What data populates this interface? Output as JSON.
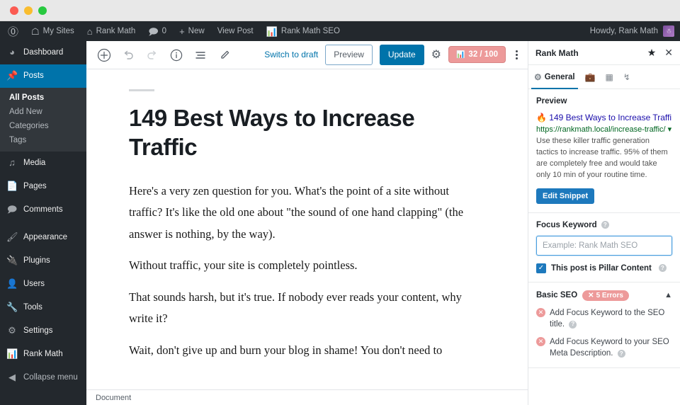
{
  "adminbar": {
    "logo_icon": "wordpress-logo-icon",
    "items": [
      {
        "label": "My Sites",
        "icon": "sites-icon"
      },
      {
        "label": "Rank Math",
        "icon": "home-icon"
      },
      {
        "label": "0",
        "icon": "comment-icon"
      },
      {
        "label": "New",
        "icon": "plus-icon"
      },
      {
        "label": "View Post",
        "icon": ""
      },
      {
        "label": "Rank Math SEO",
        "icon": "rankmath-icon"
      }
    ],
    "howdy": "Howdy, Rank Math"
  },
  "adminmenu": {
    "items": [
      {
        "label": "Dashboard",
        "icon": "dashboard-icon",
        "current": false
      },
      {
        "label": "Posts",
        "icon": "pin-icon",
        "current": true
      },
      {
        "label": "Media",
        "icon": "media-icon",
        "current": false
      },
      {
        "label": "Pages",
        "icon": "pages-icon",
        "current": false
      },
      {
        "label": "Comments",
        "icon": "comments-icon",
        "current": false
      },
      {
        "label": "Appearance",
        "icon": "appearance-icon",
        "current": false
      },
      {
        "label": "Plugins",
        "icon": "plugins-icon",
        "current": false
      },
      {
        "label": "Users",
        "icon": "users-icon",
        "current": false
      },
      {
        "label": "Tools",
        "icon": "tools-icon",
        "current": false
      },
      {
        "label": "Settings",
        "icon": "settings-icon",
        "current": false
      },
      {
        "label": "Rank Math",
        "icon": "rankmath-icon",
        "current": false
      },
      {
        "label": "Collapse menu",
        "icon": "collapse-icon",
        "current": false
      }
    ],
    "submenu": [
      {
        "label": "All Posts",
        "current": true
      },
      {
        "label": "Add New",
        "current": false
      },
      {
        "label": "Categories",
        "current": false
      },
      {
        "label": "Tags",
        "current": false
      }
    ]
  },
  "toolbar": {
    "add_icon": "add-block-icon",
    "undo_icon": "undo-icon",
    "redo_icon": "redo-icon",
    "info_icon": "content-info-icon",
    "list_icon": "list-view-icon",
    "pencil_icon": "edit-mode-icon",
    "switch_to_draft": "Switch to draft",
    "preview": "Preview",
    "update": "Update",
    "gear_icon": "settings-gear-icon",
    "seo_score": "32 / 100",
    "seo_score_icon": "rankmath-icon",
    "more_icon": "more-options-icon",
    "accent": "#0073aa",
    "score_color": "#ed9a9a"
  },
  "post": {
    "title": "149 Best Ways to Increase Traffic",
    "paragraphs": [
      "Here's a very zen question for you. What's the point of a site without traffic? It's like the old one about \"the sound of one hand clapping\" (the answer is nothing, by the way).",
      "Without traffic, your site is completely pointless.",
      "That sounds harsh, but it's true. If nobody ever reads your content, why write it?",
      "Wait, don't give up and burn your blog in shame! You don't need to"
    ],
    "status": "Document"
  },
  "rankmath": {
    "title": "Rank Math",
    "star_icon": "star-icon",
    "close_icon": "close-icon",
    "tabs": [
      {
        "label": "General",
        "icon": "gear-icon",
        "active": true
      },
      {
        "label": "",
        "icon": "briefcase-icon",
        "active": false
      },
      {
        "label": "",
        "icon": "schema-icon",
        "active": false
      },
      {
        "label": "",
        "icon": "social-share-icon",
        "active": false
      }
    ],
    "preview_label": "Preview",
    "snippet": {
      "fire_icon": "fire-emoji-icon",
      "title": "149 Best Ways to Increase Traffi…",
      "url": "https://rankmath.local/increase-traffic/",
      "url_caret_icon": "caret-down-icon",
      "description": "Use these killer traffic generation tactics to increase traffic. 95% of them are completely free and would take only 10 min of your routine time.",
      "edit_button": "Edit Snippet"
    },
    "focus_keyword": {
      "label": "Focus Keyword",
      "help_icon": "help-icon",
      "value": "",
      "placeholder": "Example: Rank Math SEO"
    },
    "pillar": {
      "label": "This post is Pillar Content",
      "checked": true,
      "check_icon": "checkmark-icon",
      "help_icon": "help-icon"
    },
    "basic_seo": {
      "label": "Basic SEO",
      "badge": "5 Errors",
      "badge_icon": "x-icon",
      "chevron_icon": "chevron-up-icon",
      "errors": [
        "Add Focus Keyword to the SEO title.",
        "Add Focus Keyword to your SEO Meta Description."
      ]
    }
  }
}
